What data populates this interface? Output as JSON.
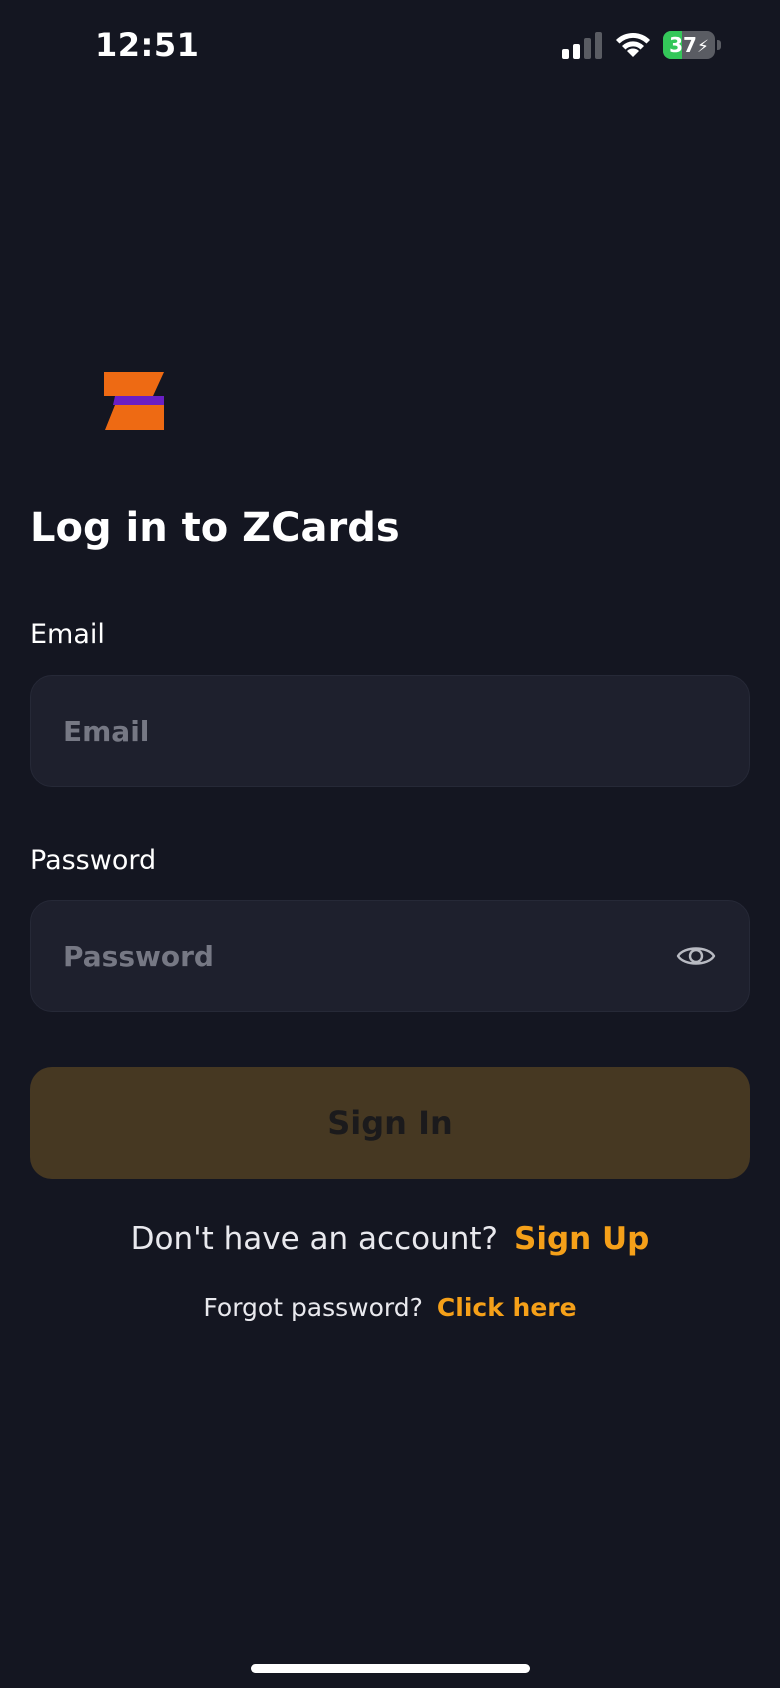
{
  "status_bar": {
    "time": "12:51",
    "battery_level": 37,
    "battery_text": "37"
  },
  "colors": {
    "background": "#141621",
    "accent": "#f5a019",
    "input_background": "#1e202d",
    "button_background": "#463822",
    "logo_orange": "#ee6a13",
    "logo_purple": "#6a1fc4"
  },
  "icons": {
    "logo": "zcards-logo",
    "password_toggle": "eye-icon",
    "signal": "cellular-signal-icon",
    "wifi": "wifi-icon",
    "battery": "battery-charging-icon"
  },
  "login": {
    "title": "Log in to ZCards",
    "email_label": "Email",
    "email_placeholder": "Email",
    "email_value": "",
    "password_label": "Password",
    "password_placeholder": "Password",
    "password_value": "",
    "signin_label": "Sign In",
    "signup_prompt": "Don't have an account?",
    "signup_link": "Sign Up",
    "forgot_prompt": "Forgot password?",
    "forgot_link": "Click here"
  }
}
